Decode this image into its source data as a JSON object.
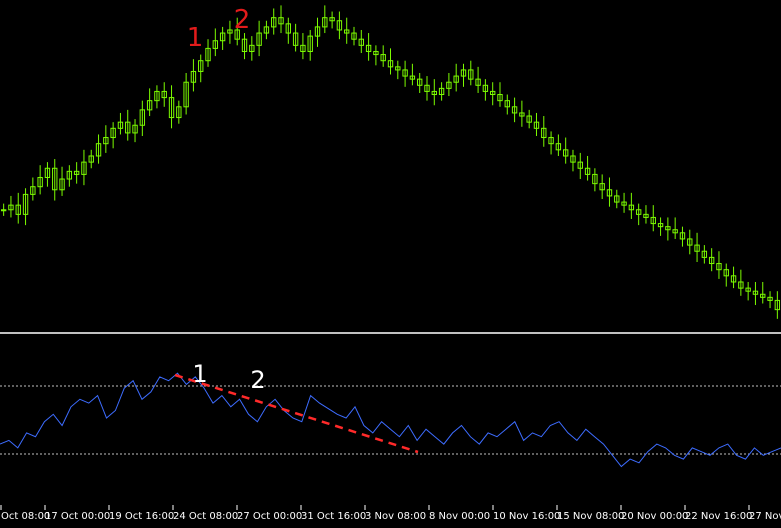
{
  "window": {
    "top_label": "~~~~~~~~~~~~~~~~~~~~~~~~~~~",
    "colors": {
      "background": "#000000",
      "candle": "#7CFC00",
      "indicator_line": "#3D6CFF",
      "level_lines": "#BFBFBF",
      "separator": "#FFFFFF",
      "trendline": "#FF2A2A",
      "price_markers": "#E21B1B",
      "indicator_markers": "#FFFFFF",
      "axis_text": "#FFFFFF"
    }
  },
  "chart_data": [
    {
      "type": "candlestick",
      "title": "",
      "markers": [
        {
          "label": "1",
          "x": "24 Oct 08:00",
          "near": "local high"
        },
        {
          "label": "2",
          "x": "27 Oct 00:00",
          "near": "higher high"
        }
      ],
      "close": [
        215,
        218,
        212,
        225,
        230,
        236,
        242,
        228,
        235,
        240,
        238,
        246,
        250,
        258,
        262,
        268,
        272,
        265,
        270,
        280,
        286,
        292,
        288,
        275,
        282,
        298,
        305,
        312,
        320,
        325,
        330,
        332,
        326,
        318,
        322,
        330,
        334,
        340,
        336,
        330,
        322,
        318,
        328,
        334,
        340,
        338,
        332,
        330,
        326,
        322,
        318,
        316,
        312,
        308,
        306,
        302,
        300,
        296,
        292,
        290,
        294,
        298,
        302,
        306,
        300,
        296,
        292,
        290,
        286,
        282,
        278,
        276,
        272,
        268,
        262,
        258,
        254,
        250,
        246,
        242,
        238,
        232,
        228,
        224,
        220,
        218,
        215,
        212,
        210,
        206,
        204,
        202,
        200,
        196,
        192,
        188,
        184,
        180,
        176,
        172,
        168,
        164,
        162,
        160,
        158,
        156,
        150
      ],
      "scale_note": "relative price; values read from candle heights"
    },
    {
      "type": "line",
      "indicator": "oscillator",
      "levels": [
        "upper dashed level",
        "lower dashed level"
      ],
      "markers": [
        {
          "label": "1",
          "x": "24 Oct 08:00"
        },
        {
          "label": "2",
          "x": "27 Oct 00:00"
        }
      ],
      "trendline": {
        "from": "22 Oct",
        "to": "8 Nov",
        "style": "dashed red"
      },
      "values": [
        36,
        38,
        34,
        42,
        40,
        48,
        52,
        46,
        56,
        60,
        58,
        62,
        50,
        54,
        66,
        70,
        60,
        64,
        72,
        70,
        74,
        68,
        72,
        66,
        58,
        62,
        56,
        60,
        52,
        48,
        56,
        60,
        54,
        50,
        48,
        62,
        58,
        55,
        52,
        50,
        56,
        46,
        42,
        48,
        44,
        40,
        46,
        38,
        44,
        40,
        36,
        42,
        46,
        40,
        36,
        42,
        40,
        44,
        48,
        38,
        42,
        40,
        46,
        48,
        42,
        38,
        44,
        40,
        36,
        30,
        24,
        28,
        26,
        32,
        36,
        34,
        30,
        28,
        34,
        32,
        30,
        34,
        36,
        30,
        28,
        34,
        30,
        32,
        34
      ]
    }
  ],
  "x_axis": {
    "ticks": [
      "Oct 08:00",
      "17 Oct 00:00",
      "19 Oct 16:00",
      "24 Oct 08:00",
      "27 Oct 00:00",
      "31 Oct 16:00",
      "3 Nov 08:00",
      "8 Nov 00:00",
      "10 Nov 16:00",
      "15 Nov 08:00",
      "20 Nov 00:00",
      "22 Nov 16:00",
      "27 Nov 0"
    ]
  }
}
